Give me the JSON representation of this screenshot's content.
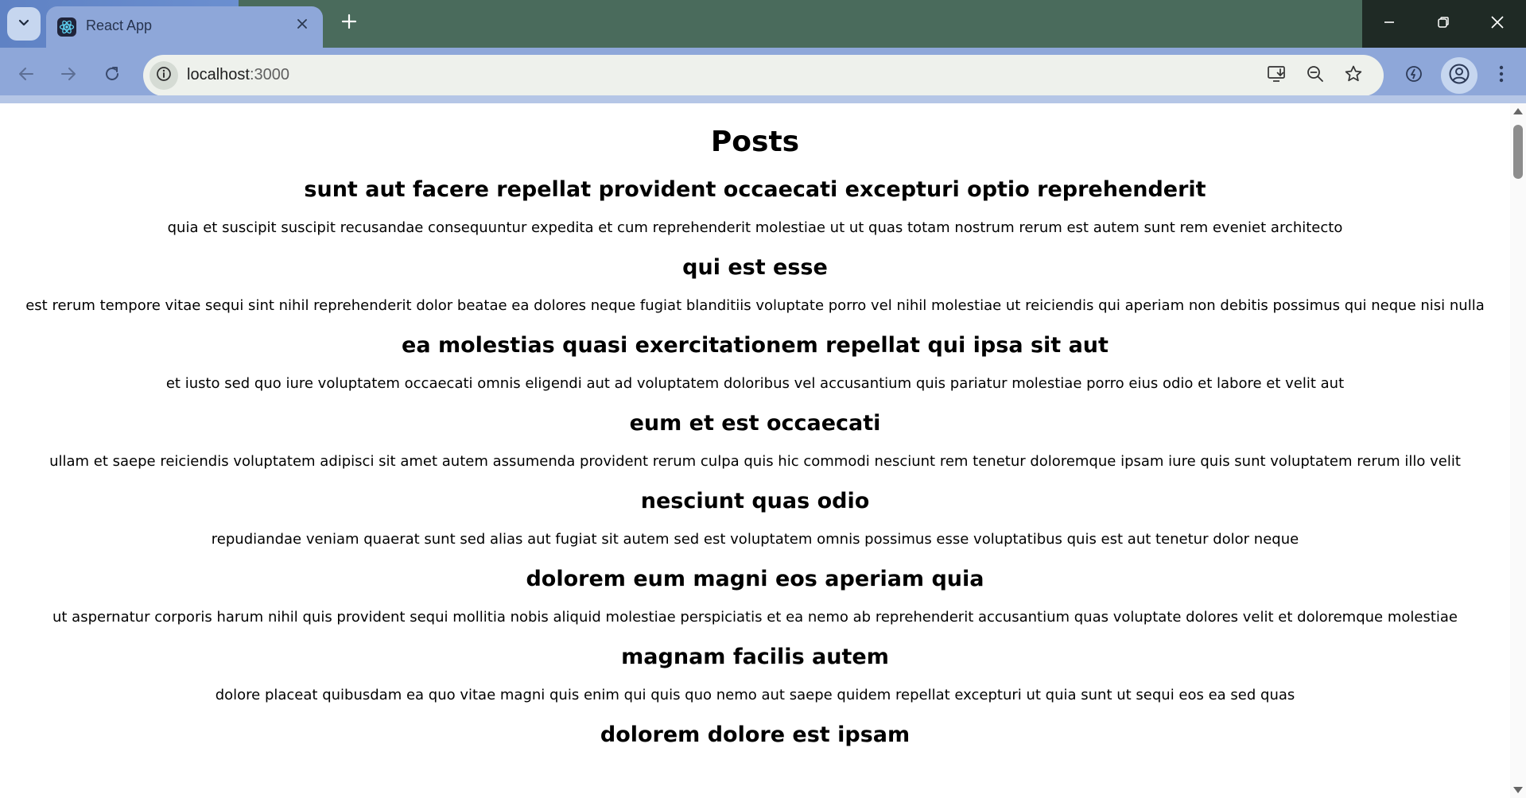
{
  "browser": {
    "tab": {
      "title": "React App",
      "favicon": "react-logo-icon"
    },
    "address": {
      "host": "localhost",
      "port": ":3000"
    },
    "icons": {
      "tab_search": "chevron-down-icon",
      "new_tab": "plus-icon",
      "minimize": "minimize-icon",
      "restore": "restore-icon",
      "close": "close-icon",
      "back": "back-arrow-icon",
      "forward": "forward-arrow-icon",
      "reload": "reload-icon",
      "site_info": "info-icon",
      "install": "install-app-icon",
      "zoom": "zoom-out-icon",
      "bookmark": "star-icon",
      "extension": "performance-icon",
      "profile": "profile-icon",
      "menu": "kebab-menu-icon"
    }
  },
  "page": {
    "heading": "Posts",
    "posts": [
      {
        "title": "sunt aut facere repellat provident occaecati excepturi optio reprehenderit",
        "body": "quia et suscipit suscipit recusandae consequuntur expedita et cum reprehenderit molestiae ut ut quas totam nostrum rerum est autem sunt rem eveniet architecto"
      },
      {
        "title": "qui est esse",
        "body": "est rerum tempore vitae sequi sint nihil reprehenderit dolor beatae ea dolores neque fugiat blanditiis voluptate porro vel nihil molestiae ut reiciendis qui aperiam non debitis possimus qui neque nisi nulla"
      },
      {
        "title": "ea molestias quasi exercitationem repellat qui ipsa sit aut",
        "body": "et iusto sed quo iure voluptatem occaecati omnis eligendi aut ad voluptatem doloribus vel accusantium quis pariatur molestiae porro eius odio et labore et velit aut"
      },
      {
        "title": "eum et est occaecati",
        "body": "ullam et saepe reiciendis voluptatem adipisci sit amet autem assumenda provident rerum culpa quis hic commodi nesciunt rem tenetur doloremque ipsam iure quis sunt voluptatem rerum illo velit"
      },
      {
        "title": "nesciunt quas odio",
        "body": "repudiandae veniam quaerat sunt sed alias aut fugiat sit autem sed est voluptatem omnis possimus esse voluptatibus quis est aut tenetur dolor neque"
      },
      {
        "title": "dolorem eum magni eos aperiam quia",
        "body": "ut aspernatur corporis harum nihil quis provident sequi mollitia nobis aliquid molestiae perspiciatis et ea nemo ab reprehenderit accusantium quas voluptate dolores velit et doloremque molestiae"
      },
      {
        "title": "magnam facilis autem",
        "body": "dolore placeat quibusdam ea quo vitae magni quis enim qui quis quo nemo aut saepe quidem repellat excepturi ut quia sunt ut sequi eos ea sed quas"
      },
      {
        "title": "dolorem dolore est ipsam",
        "body": ""
      }
    ]
  },
  "colors": {
    "tab_active": "#8ea7d9",
    "titlebar": "#4a6b5c",
    "omnibox": "#eef1ec"
  }
}
